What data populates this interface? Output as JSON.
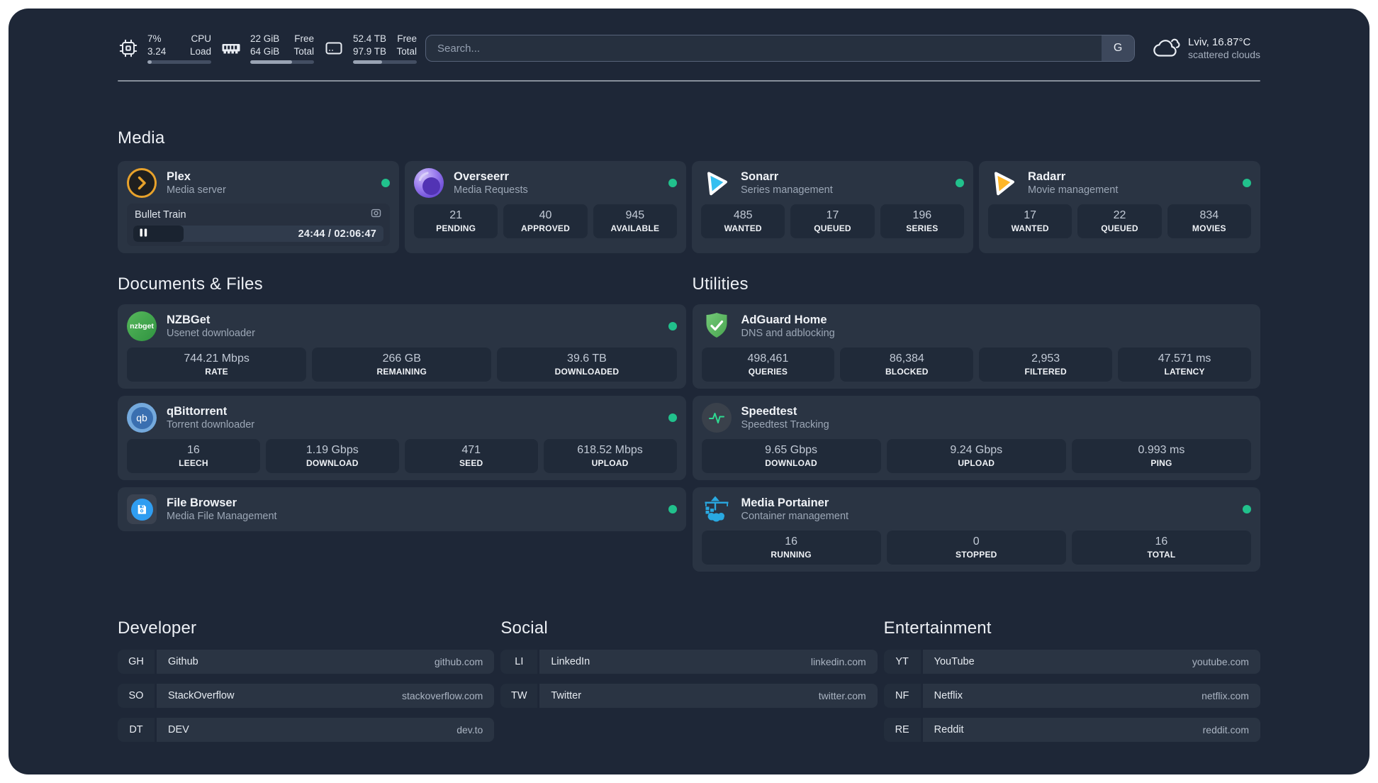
{
  "topbar": {
    "resources": [
      {
        "icon": "cpu",
        "value1": "7%",
        "value2": "3.24",
        "label1": "CPU",
        "label2": "Load",
        "percent": 7
      },
      {
        "icon": "memory",
        "value1": "22 GiB",
        "value2": "64 GiB",
        "label1": "Free",
        "label2": "Total",
        "percent": 66
      },
      {
        "icon": "disk",
        "value1": "52.4 TB",
        "value2": "97.9 TB",
        "label1": "Free",
        "label2": "Total",
        "percent": 46
      }
    ],
    "search": {
      "placeholder": "Search...",
      "button": "G"
    },
    "weather": {
      "location_temp": "Lviv, 16.87°C",
      "condition": "scattered clouds"
    }
  },
  "media": {
    "title": "Media",
    "plex": {
      "name": "Plex",
      "desc": "Media server",
      "now_playing": "Bullet Train",
      "time": "24:44 / 02:06:47",
      "progress_percent": 20
    },
    "overseerr": {
      "name": "Overseerr",
      "desc": "Media Requests",
      "stats": [
        {
          "value": "21",
          "label": "PENDING"
        },
        {
          "value": "40",
          "label": "APPROVED"
        },
        {
          "value": "945",
          "label": "AVAILABLE"
        }
      ]
    },
    "sonarr": {
      "name": "Sonarr",
      "desc": "Series management",
      "stats": [
        {
          "value": "485",
          "label": "WANTED"
        },
        {
          "value": "17",
          "label": "QUEUED"
        },
        {
          "value": "196",
          "label": "SERIES"
        }
      ]
    },
    "radarr": {
      "name": "Radarr",
      "desc": "Movie management",
      "stats": [
        {
          "value": "17",
          "label": "WANTED"
        },
        {
          "value": "22",
          "label": "QUEUED"
        },
        {
          "value": "834",
          "label": "MOVIES"
        }
      ]
    }
  },
  "documents": {
    "title": "Documents & Files",
    "nzbget": {
      "name": "NZBGet",
      "desc": "Usenet downloader",
      "icon_text": "nzbget",
      "stats": [
        {
          "value": "744.21 Mbps",
          "label": "RATE"
        },
        {
          "value": "266 GB",
          "label": "REMAINING"
        },
        {
          "value": "39.6 TB",
          "label": "DOWNLOADED"
        }
      ]
    },
    "qbittorrent": {
      "name": "qBittorrent",
      "desc": "Torrent downloader",
      "icon_text": "qb",
      "stats": [
        {
          "value": "16",
          "label": "LEECH"
        },
        {
          "value": "1.19 Gbps",
          "label": "DOWNLOAD"
        },
        {
          "value": "471",
          "label": "SEED"
        },
        {
          "value": "618.52 Mbps",
          "label": "UPLOAD"
        }
      ]
    },
    "filebrowser": {
      "name": "File Browser",
      "desc": "Media File Management"
    }
  },
  "utilities": {
    "title": "Utilities",
    "adguard": {
      "name": "AdGuard Home",
      "desc": "DNS and adblocking",
      "stats": [
        {
          "value": "498,461",
          "label": "QUERIES"
        },
        {
          "value": "86,384",
          "label": "BLOCKED"
        },
        {
          "value": "2,953",
          "label": "FILTERED"
        },
        {
          "value": "47.571 ms",
          "label": "LATENCY"
        }
      ]
    },
    "speedtest": {
      "name": "Speedtest",
      "desc": "Speedtest Tracking",
      "stats": [
        {
          "value": "9.65 Gbps",
          "label": "DOWNLOAD"
        },
        {
          "value": "9.24 Gbps",
          "label": "UPLOAD"
        },
        {
          "value": "0.993 ms",
          "label": "PING"
        }
      ]
    },
    "portainer": {
      "name": "Media Portainer",
      "desc": "Container management",
      "stats": [
        {
          "value": "16",
          "label": "RUNNING"
        },
        {
          "value": "0",
          "label": "STOPPED"
        },
        {
          "value": "16",
          "label": "TOTAL"
        }
      ]
    }
  },
  "bookmarks": {
    "developer": {
      "title": "Developer",
      "items": [
        {
          "abbr": "GH",
          "name": "Github",
          "url": "github.com"
        },
        {
          "abbr": "SO",
          "name": "StackOverflow",
          "url": "stackoverflow.com"
        },
        {
          "abbr": "DT",
          "name": "DEV",
          "url": "dev.to"
        }
      ]
    },
    "social": {
      "title": "Social",
      "items": [
        {
          "abbr": "LI",
          "name": "LinkedIn",
          "url": "linkedin.com"
        },
        {
          "abbr": "TW",
          "name": "Twitter",
          "url": "twitter.com"
        }
      ]
    },
    "entertainment": {
      "title": "Entertainment",
      "items": [
        {
          "abbr": "YT",
          "name": "YouTube",
          "url": "youtube.com"
        },
        {
          "abbr": "NF",
          "name": "Netflix",
          "url": "netflix.com"
        },
        {
          "abbr": "RE",
          "name": "Reddit",
          "url": "reddit.com"
        }
      ]
    }
  }
}
